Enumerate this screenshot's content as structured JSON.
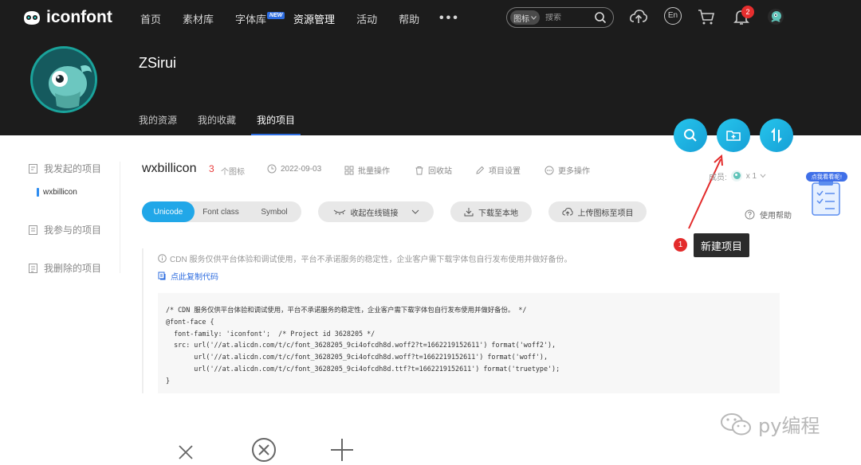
{
  "app": {
    "logo_text": "iconfont"
  },
  "nav": {
    "items": [
      "首页",
      "素材库",
      "字体库",
      "资源管理",
      "活动",
      "帮助"
    ],
    "new_badge": "NEW",
    "more": "•••"
  },
  "search": {
    "type_label": "图标",
    "placeholder": "搜索"
  },
  "header_icons": {
    "language": "En",
    "notification_count": "2"
  },
  "profile": {
    "username": "ZSirui",
    "tabs": [
      "我的资源",
      "我的收藏",
      "我的项目"
    ]
  },
  "sidebar": {
    "started_projects": "我发起的项目",
    "current_project": "wxbillicon",
    "joined_projects": "我参与的项目",
    "deleted_projects": "我删除的项目"
  },
  "project": {
    "name": "wxbillicon",
    "icon_count": "3",
    "icon_count_label": "个图标",
    "date": "2022-09-03",
    "batch": "批量操作",
    "recycle": "回收站",
    "settings": "项目设置",
    "more_actions": "更多操作",
    "members_label": "成员:",
    "members_count": "x 1"
  },
  "toolbar": {
    "format_tabs": [
      "Unicode",
      "Font class",
      "Symbol"
    ],
    "collapse_link": "收起在线链接",
    "download": "下载至本地",
    "upload": "上传图标至项目",
    "help": "使用帮助"
  },
  "tooltip": {
    "step": "1",
    "text": "新建项目"
  },
  "notice": {
    "text": "CDN 服务仅供平台体验和调试使用，平台不承诺服务的稳定性，企业客户需下载字体包自行发布使用并做好备份。",
    "copy_code": "点此复制代码"
  },
  "code": {
    "lines": [
      "/* CDN 服务仅供平台体验和调试使用，平台不承诺服务的稳定性，企业客户需下载字体包自行发布使用并做好备份。 */",
      "@font-face {",
      "  font-family: 'iconfont';  /* Project id 3628205 */",
      "  src: url('//at.alicdn.com/t/c/font_3628205_9ci4ofcdh8d.woff2?t=1662219152611') format('woff2'),",
      "       url('//at.alicdn.com/t/c/font_3628205_9ci4ofcdh8d.woff?t=1662219152611') format('woff'),",
      "       url('//at.alicdn.com/t/c/font_3628205_9ci4ofcdh8d.ttf?t=1662219152611') format('truetype');",
      "}"
    ]
  },
  "promo": {
    "text": "点我看看呢!"
  },
  "watermark": {
    "text": "py编程"
  },
  "colors": {
    "accent": "#21a7e8",
    "header_bg": "#1c1c1c",
    "link": "#2d6cdf",
    "badge_red": "#e32b2b"
  }
}
